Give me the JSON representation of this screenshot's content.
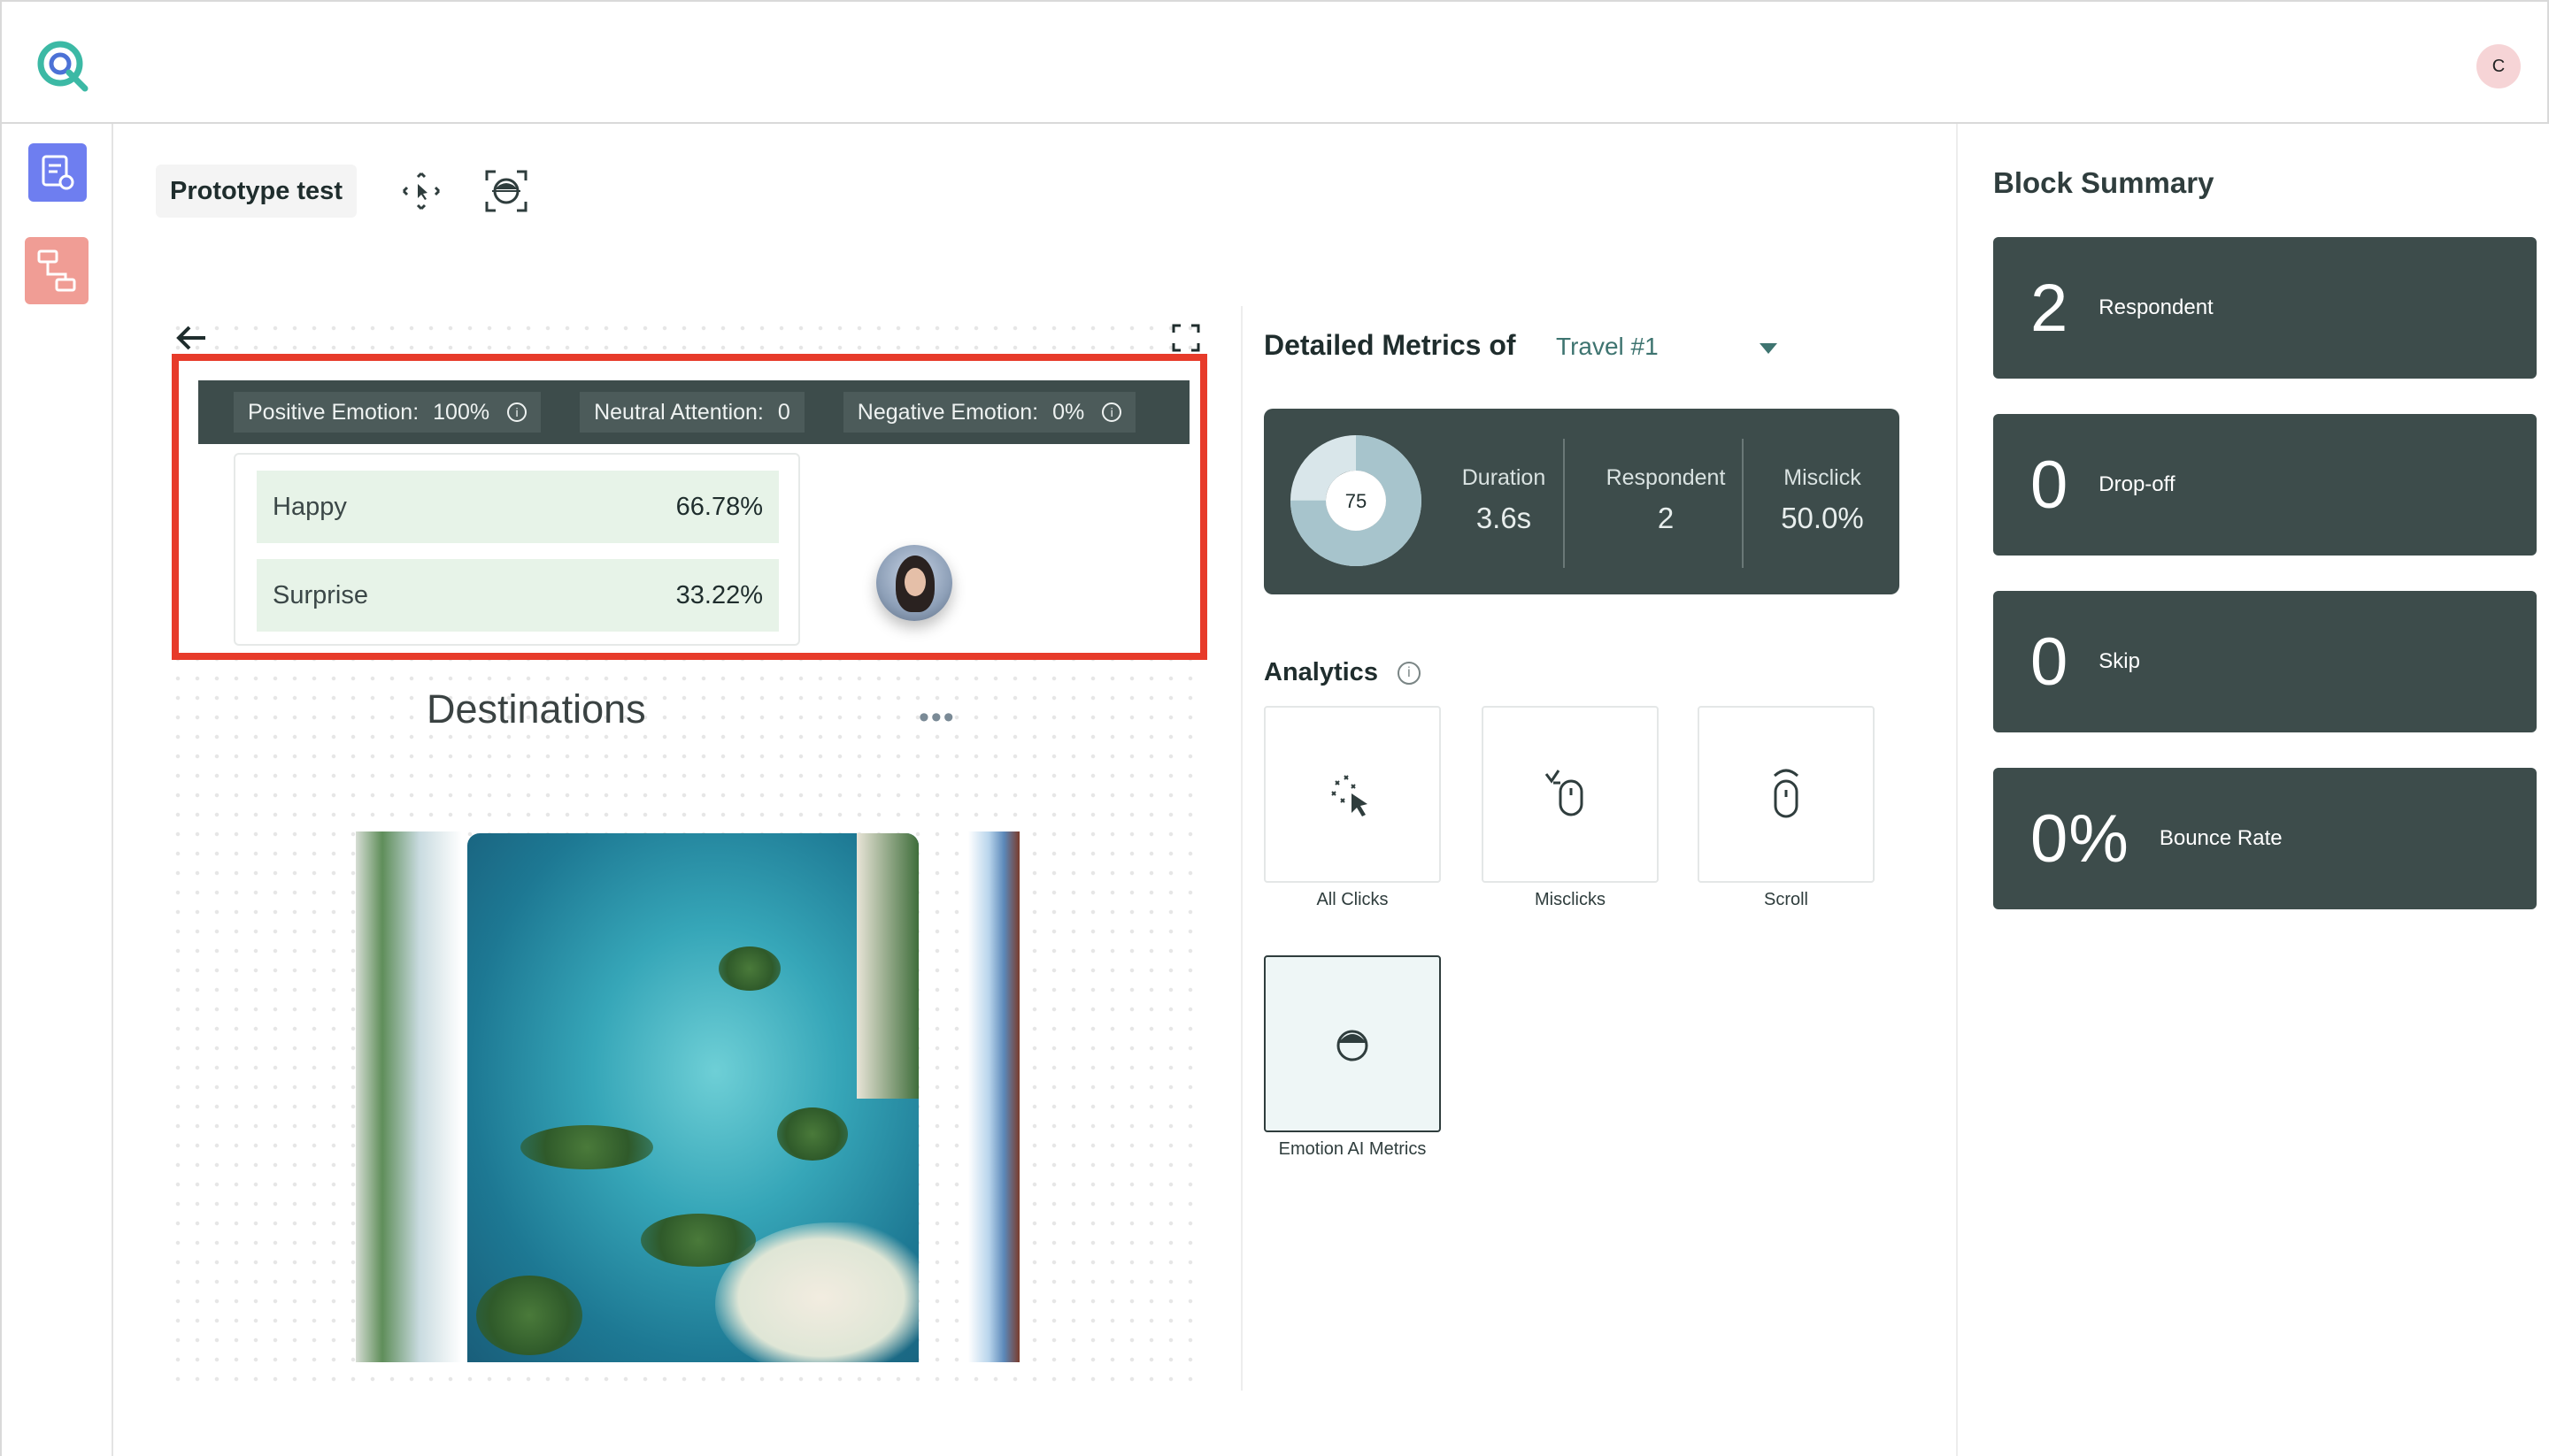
{
  "header": {
    "user_initial": "C"
  },
  "toolbar": {
    "title": "Prototype test"
  },
  "emotion_bar": {
    "positive_label": "Positive Emotion:",
    "positive_value": "100%",
    "neutral_label": "Neutral Attention:",
    "neutral_value": "0",
    "negative_label": "Negative Emotion:",
    "negative_value": "0%"
  },
  "emotions": [
    {
      "label": "Happy",
      "value": "66.78%"
    },
    {
      "label": "Surprise",
      "value": "33.22%"
    }
  ],
  "preview": {
    "title": "Destinations",
    "more": "•••"
  },
  "metrics": {
    "title": "Detailed Metrics of",
    "selected": "Travel #1",
    "score": "75",
    "score_fraction": 0.75,
    "duration_label": "Duration",
    "duration_value": "3.6s",
    "respondent_label": "Respondent",
    "respondent_value": "2",
    "misclick_label": "Misclick",
    "misclick_value": "50.0%"
  },
  "analytics": {
    "title": "Analytics",
    "info": "i",
    "tiles": [
      "All Clicks",
      "Misclicks",
      "Scroll",
      "Emotion AI Metrics"
    ]
  },
  "block_summary": {
    "title": "Block Summary",
    "cards": [
      {
        "value": "2",
        "label": "Respondent"
      },
      {
        "value": "0",
        "label": "Drop-off"
      },
      {
        "value": "0",
        "label": "Skip"
      },
      {
        "value": "0%",
        "label": "Bounce Rate"
      }
    ]
  },
  "colors": {
    "dark_card": "#3d4c4b",
    "highlight": "#e73b2a",
    "accent": "#3e7470"
  }
}
